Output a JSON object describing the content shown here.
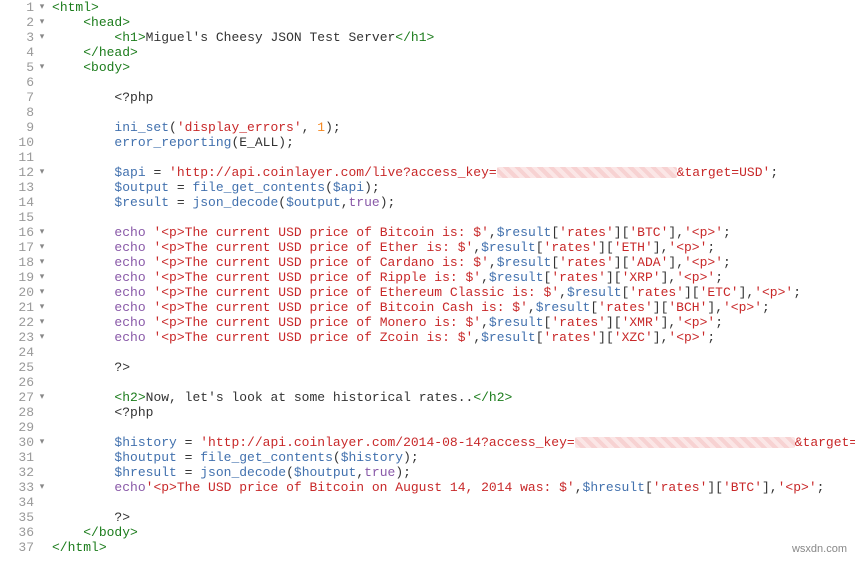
{
  "watermark": "wsxdn.com",
  "lines": {
    "l1": {
      "fold": "▾",
      "indent": 0,
      "tokens": [
        {
          "t": "<",
          "c": "tag"
        },
        {
          "t": "html",
          "c": "tag"
        },
        {
          "t": ">",
          "c": "tag"
        }
      ]
    },
    "l2": {
      "fold": "▾",
      "indent": 1,
      "tokens": [
        {
          "t": "<",
          "c": "tag"
        },
        {
          "t": "head",
          "c": "tag"
        },
        {
          "t": ">",
          "c": "tag"
        }
      ]
    },
    "l3": {
      "fold": "▾",
      "indent": 2,
      "tokens": [
        {
          "t": "<",
          "c": "tag"
        },
        {
          "t": "h1",
          "c": "tag"
        },
        {
          "t": ">",
          "c": "tag"
        },
        {
          "t": "Miguel's Cheesy JSON Test Server",
          "c": "def"
        },
        {
          "t": "</",
          "c": "tag"
        },
        {
          "t": "h1",
          "c": "tag"
        },
        {
          "t": ">",
          "c": "tag"
        }
      ]
    },
    "l4": {
      "fold": "",
      "indent": 1,
      "tokens": [
        {
          "t": "</",
          "c": "tag"
        },
        {
          "t": "head",
          "c": "tag"
        },
        {
          "t": ">",
          "c": "tag"
        }
      ]
    },
    "l5": {
      "fold": "▾",
      "indent": 1,
      "tokens": [
        {
          "t": "<",
          "c": "tag"
        },
        {
          "t": "body",
          "c": "tag"
        },
        {
          "t": ">",
          "c": "tag"
        }
      ]
    },
    "l6": {
      "fold": "",
      "indent": 0,
      "tokens": []
    },
    "l7": {
      "fold": "",
      "indent": 2,
      "tokens": [
        {
          "t": "<?php",
          "c": "def"
        }
      ]
    },
    "l8": {
      "fold": "",
      "indent": 0,
      "tokens": []
    },
    "l9": {
      "fold": "",
      "indent": 2,
      "tokens": [
        {
          "t": "ini_set",
          "c": "func"
        },
        {
          "t": "(",
          "c": "bracket"
        },
        {
          "t": "'display_errors'",
          "c": "string"
        },
        {
          "t": ", ",
          "c": "def"
        },
        {
          "t": "1",
          "c": "num"
        },
        {
          "t": ");",
          "c": "bracket"
        }
      ]
    },
    "l10": {
      "fold": "",
      "indent": 2,
      "tokens": [
        {
          "t": "error_reporting",
          "c": "func"
        },
        {
          "t": "(",
          "c": "bracket"
        },
        {
          "t": "E_ALL",
          "c": "def"
        },
        {
          "t": ");",
          "c": "bracket"
        }
      ]
    },
    "l11": {
      "fold": "",
      "indent": 0,
      "tokens": []
    },
    "l12": {
      "fold": "▾",
      "indent": 2,
      "tokens": [
        {
          "t": "$api",
          "c": "var"
        },
        {
          "t": " = ",
          "c": "def"
        },
        {
          "t": "'http://api.coinlayer.com/live?access_key=",
          "c": "string"
        },
        {
          "t": "",
          "c": "redsmall"
        },
        {
          "t": "&target=USD'",
          "c": "string"
        },
        {
          "t": ";",
          "c": "bracket"
        }
      ]
    },
    "l13": {
      "fold": "",
      "indent": 2,
      "tokens": [
        {
          "t": "$output",
          "c": "var"
        },
        {
          "t": " = ",
          "c": "def"
        },
        {
          "t": "file_get_contents",
          "c": "func"
        },
        {
          "t": "(",
          "c": "bracket"
        },
        {
          "t": "$api",
          "c": "var"
        },
        {
          "t": ");",
          "c": "bracket"
        }
      ]
    },
    "l14": {
      "fold": "",
      "indent": 2,
      "tokens": [
        {
          "t": "$result",
          "c": "var"
        },
        {
          "t": " = ",
          "c": "def"
        },
        {
          "t": "json_decode",
          "c": "func"
        },
        {
          "t": "(",
          "c": "bracket"
        },
        {
          "t": "$output",
          "c": "var"
        },
        {
          "t": ",",
          "c": "bracket"
        },
        {
          "t": "true",
          "c": "keyword"
        },
        {
          "t": ");",
          "c": "bracket"
        }
      ]
    },
    "l15": {
      "fold": "",
      "indent": 0,
      "tokens": []
    },
    "l16": {
      "fold": "▾",
      "indent": 2,
      "tokens": [
        {
          "t": "echo",
          "c": "keyword"
        },
        {
          "t": " ",
          "c": "def"
        },
        {
          "t": "'<p>The current USD price of Bitcoin is: $'",
          "c": "string"
        },
        {
          "t": ",",
          "c": "bracket"
        },
        {
          "t": "$result",
          "c": "var"
        },
        {
          "t": "[",
          "c": "bracket"
        },
        {
          "t": "'rates'",
          "c": "string"
        },
        {
          "t": "][",
          "c": "bracket"
        },
        {
          "t": "'BTC'",
          "c": "string"
        },
        {
          "t": "],",
          "c": "bracket"
        },
        {
          "t": "'<p>'",
          "c": "string"
        },
        {
          "t": ";",
          "c": "bracket"
        }
      ]
    },
    "l17": {
      "fold": "▾",
      "indent": 2,
      "tokens": [
        {
          "t": "echo",
          "c": "keyword"
        },
        {
          "t": " ",
          "c": "def"
        },
        {
          "t": "'<p>The current USD price of Ether is: $'",
          "c": "string"
        },
        {
          "t": ",",
          "c": "bracket"
        },
        {
          "t": "$result",
          "c": "var"
        },
        {
          "t": "[",
          "c": "bracket"
        },
        {
          "t": "'rates'",
          "c": "string"
        },
        {
          "t": "][",
          "c": "bracket"
        },
        {
          "t": "'ETH'",
          "c": "string"
        },
        {
          "t": "],",
          "c": "bracket"
        },
        {
          "t": "'<p>'",
          "c": "string"
        },
        {
          "t": ";",
          "c": "bracket"
        }
      ]
    },
    "l18": {
      "fold": "▾",
      "indent": 2,
      "tokens": [
        {
          "t": "echo",
          "c": "keyword"
        },
        {
          "t": " ",
          "c": "def"
        },
        {
          "t": "'<p>The current USD price of Cardano is: $'",
          "c": "string"
        },
        {
          "t": ",",
          "c": "bracket"
        },
        {
          "t": "$result",
          "c": "var"
        },
        {
          "t": "[",
          "c": "bracket"
        },
        {
          "t": "'rates'",
          "c": "string"
        },
        {
          "t": "][",
          "c": "bracket"
        },
        {
          "t": "'ADA'",
          "c": "string"
        },
        {
          "t": "],",
          "c": "bracket"
        },
        {
          "t": "'<p>'",
          "c": "string"
        },
        {
          "t": ";",
          "c": "bracket"
        }
      ]
    },
    "l19": {
      "fold": "▾",
      "indent": 2,
      "tokens": [
        {
          "t": "echo",
          "c": "keyword"
        },
        {
          "t": " ",
          "c": "def"
        },
        {
          "t": "'<p>The current USD price of Ripple is: $'",
          "c": "string"
        },
        {
          "t": ",",
          "c": "bracket"
        },
        {
          "t": "$result",
          "c": "var"
        },
        {
          "t": "[",
          "c": "bracket"
        },
        {
          "t": "'rates'",
          "c": "string"
        },
        {
          "t": "][",
          "c": "bracket"
        },
        {
          "t": "'XRP'",
          "c": "string"
        },
        {
          "t": "],",
          "c": "bracket"
        },
        {
          "t": "'<p>'",
          "c": "string"
        },
        {
          "t": ";",
          "c": "bracket"
        }
      ]
    },
    "l20": {
      "fold": "▾",
      "indent": 2,
      "tokens": [
        {
          "t": "echo",
          "c": "keyword"
        },
        {
          "t": " ",
          "c": "def"
        },
        {
          "t": "'<p>The current USD price of Ethereum Classic is: $'",
          "c": "string"
        },
        {
          "t": ",",
          "c": "bracket"
        },
        {
          "t": "$result",
          "c": "var"
        },
        {
          "t": "[",
          "c": "bracket"
        },
        {
          "t": "'rates'",
          "c": "string"
        },
        {
          "t": "][",
          "c": "bracket"
        },
        {
          "t": "'ETC'",
          "c": "string"
        },
        {
          "t": "],",
          "c": "bracket"
        },
        {
          "t": "'<p>'",
          "c": "string"
        },
        {
          "t": ";",
          "c": "bracket"
        }
      ]
    },
    "l21": {
      "fold": "▾",
      "indent": 2,
      "tokens": [
        {
          "t": "echo",
          "c": "keyword"
        },
        {
          "t": " ",
          "c": "def"
        },
        {
          "t": "'<p>The current USD price of Bitcoin Cash is: $'",
          "c": "string"
        },
        {
          "t": ",",
          "c": "bracket"
        },
        {
          "t": "$result",
          "c": "var"
        },
        {
          "t": "[",
          "c": "bracket"
        },
        {
          "t": "'rates'",
          "c": "string"
        },
        {
          "t": "][",
          "c": "bracket"
        },
        {
          "t": "'BCH'",
          "c": "string"
        },
        {
          "t": "],",
          "c": "bracket"
        },
        {
          "t": "'<p>'",
          "c": "string"
        },
        {
          "t": ";",
          "c": "bracket"
        }
      ]
    },
    "l22": {
      "fold": "▾",
      "indent": 2,
      "tokens": [
        {
          "t": "echo",
          "c": "keyword"
        },
        {
          "t": " ",
          "c": "def"
        },
        {
          "t": "'<p>The current USD price of Monero is: $'",
          "c": "string"
        },
        {
          "t": ",",
          "c": "bracket"
        },
        {
          "t": "$result",
          "c": "var"
        },
        {
          "t": "[",
          "c": "bracket"
        },
        {
          "t": "'rates'",
          "c": "string"
        },
        {
          "t": "][",
          "c": "bracket"
        },
        {
          "t": "'XMR'",
          "c": "string"
        },
        {
          "t": "],",
          "c": "bracket"
        },
        {
          "t": "'<p>'",
          "c": "string"
        },
        {
          "t": ";",
          "c": "bracket"
        }
      ]
    },
    "l23": {
      "fold": "▾",
      "indent": 2,
      "tokens": [
        {
          "t": "echo",
          "c": "keyword"
        },
        {
          "t": " ",
          "c": "def"
        },
        {
          "t": "'<p>The current USD price of Zcoin is: $'",
          "c": "string"
        },
        {
          "t": ",",
          "c": "bracket"
        },
        {
          "t": "$result",
          "c": "var"
        },
        {
          "t": "[",
          "c": "bracket"
        },
        {
          "t": "'rates'",
          "c": "string"
        },
        {
          "t": "][",
          "c": "bracket"
        },
        {
          "t": "'XZC'",
          "c": "string"
        },
        {
          "t": "],",
          "c": "bracket"
        },
        {
          "t": "'<p>'",
          "c": "string"
        },
        {
          "t": ";",
          "c": "bracket"
        }
      ]
    },
    "l24": {
      "fold": "",
      "indent": 0,
      "tokens": []
    },
    "l25": {
      "fold": "",
      "indent": 2,
      "tokens": [
        {
          "t": "?>",
          "c": "def"
        }
      ]
    },
    "l26": {
      "fold": "",
      "indent": 0,
      "tokens": []
    },
    "l27": {
      "fold": "▾",
      "indent": 2,
      "tokens": [
        {
          "t": "<",
          "c": "tag"
        },
        {
          "t": "h2",
          "c": "tag"
        },
        {
          "t": ">",
          "c": "tag"
        },
        {
          "t": "Now, let's look at some historical rates..",
          "c": "def"
        },
        {
          "t": "</",
          "c": "tag"
        },
        {
          "t": "h2",
          "c": "tag"
        },
        {
          "t": ">",
          "c": "tag"
        }
      ]
    },
    "l28": {
      "fold": "",
      "indent": 2,
      "tokens": [
        {
          "t": "<?php",
          "c": "def"
        }
      ]
    },
    "l29": {
      "fold": "",
      "indent": 0,
      "tokens": []
    },
    "l30": {
      "fold": "▾",
      "indent": 2,
      "tokens": [
        {
          "t": "$history",
          "c": "var"
        },
        {
          "t": " = ",
          "c": "def"
        },
        {
          "t": "'http://api.coinlayer.com/2014-08-14?access_key=",
          "c": "string"
        },
        {
          "t": "",
          "c": "red"
        },
        {
          "t": "&target=USD'",
          "c": "string"
        },
        {
          "t": ";",
          "c": "bracket"
        }
      ]
    },
    "l31": {
      "fold": "",
      "indent": 2,
      "tokens": [
        {
          "t": "$houtput",
          "c": "var"
        },
        {
          "t": " = ",
          "c": "def"
        },
        {
          "t": "file_get_contents",
          "c": "func"
        },
        {
          "t": "(",
          "c": "bracket"
        },
        {
          "t": "$history",
          "c": "var"
        },
        {
          "t": ");",
          "c": "bracket"
        }
      ]
    },
    "l32": {
      "fold": "",
      "indent": 2,
      "tokens": [
        {
          "t": "$hresult",
          "c": "var"
        },
        {
          "t": " = ",
          "c": "def"
        },
        {
          "t": "json_decode",
          "c": "func"
        },
        {
          "t": "(",
          "c": "bracket"
        },
        {
          "t": "$houtput",
          "c": "var"
        },
        {
          "t": ",",
          "c": "bracket"
        },
        {
          "t": "true",
          "c": "keyword"
        },
        {
          "t": ");",
          "c": "bracket"
        }
      ]
    },
    "l33": {
      "fold": "▾",
      "indent": 2,
      "tokens": [
        {
          "t": "echo",
          "c": "keyword"
        },
        {
          "t": "'<p>The USD price of Bitcoin on August 14, 2014 was: $'",
          "c": "string"
        },
        {
          "t": ",",
          "c": "bracket"
        },
        {
          "t": "$hresult",
          "c": "var"
        },
        {
          "t": "[",
          "c": "bracket"
        },
        {
          "t": "'rates'",
          "c": "string"
        },
        {
          "t": "][",
          "c": "bracket"
        },
        {
          "t": "'BTC'",
          "c": "string"
        },
        {
          "t": "],",
          "c": "bracket"
        },
        {
          "t": "'<p>'",
          "c": "string"
        },
        {
          "t": ";",
          "c": "bracket"
        }
      ]
    },
    "l34": {
      "fold": "",
      "indent": 0,
      "tokens": []
    },
    "l35": {
      "fold": "",
      "indent": 2,
      "tokens": [
        {
          "t": "?>",
          "c": "def"
        }
      ]
    },
    "l36": {
      "fold": "",
      "indent": 1,
      "tokens": [
        {
          "t": "</",
          "c": "tag"
        },
        {
          "t": "body",
          "c": "tag"
        },
        {
          "t": ">",
          "c": "tag"
        }
      ]
    },
    "l37": {
      "fold": "",
      "indent": 0,
      "tokens": [
        {
          "t": "</",
          "c": "tag"
        },
        {
          "t": "html",
          "c": "tag"
        },
        {
          "t": ">",
          "c": "tag"
        }
      ]
    }
  }
}
